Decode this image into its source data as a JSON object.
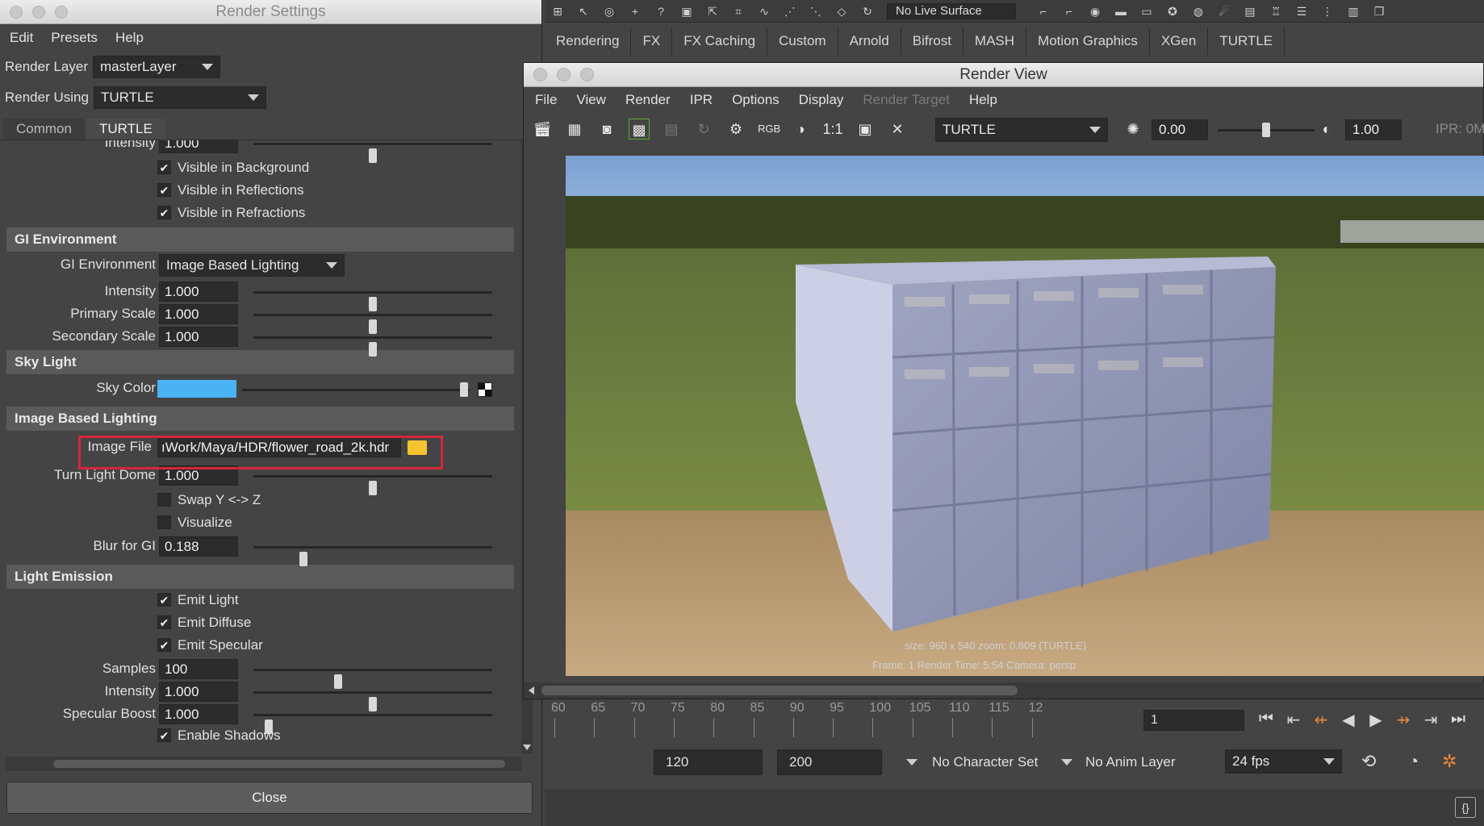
{
  "top_toolbar": {
    "live_surface": "No Live Surface"
  },
  "shelf_tabs": [
    "Rendering",
    "FX",
    "FX Caching",
    "Custom",
    "Arnold",
    "Bifrost",
    "MASH",
    "Motion Graphics",
    "XGen",
    "TURTLE"
  ],
  "render_settings": {
    "title": "Render Settings",
    "menu": [
      "Edit",
      "Presets",
      "Help"
    ],
    "render_layer_label": "Render Layer",
    "render_layer_value": "masterLayer",
    "render_using_label": "Render Using",
    "render_using_value": "TURTLE",
    "tabs": [
      "Common",
      "TURTLE"
    ],
    "active_tab": "TURTLE",
    "top_intensity": {
      "label": "Intensity",
      "value": "1.000",
      "slider": 0.5
    },
    "visible_checks": [
      {
        "label": "Visible in Background",
        "checked": true
      },
      {
        "label": "Visible in Reflections",
        "checked": true
      },
      {
        "label": "Visible in Refractions",
        "checked": true
      }
    ],
    "gi_section": "GI Environment",
    "gi_env_label": "GI Environment",
    "gi_env_value": "Image Based Lighting",
    "gi_fields": [
      {
        "label": "Intensity",
        "value": "1.000",
        "slider": 0.5
      },
      {
        "label": "Primary Scale",
        "value": "1.000",
        "slider": 0.5
      },
      {
        "label": "Secondary Scale",
        "value": "1.000",
        "slider": 0.5
      }
    ],
    "sky_section": "Sky Light",
    "sky_color_label": "Sky Color",
    "sky_color": "#4ab3f4",
    "ibl_section": "Image Based Lighting",
    "image_file_label": "Image File",
    "image_file_value": "ıWork/Maya/HDR/flower_road_2k.hdr",
    "turn_dome": {
      "label": "Turn Light Dome",
      "value": "1.000",
      "slider": 0.5
    },
    "ibl_checks": [
      {
        "label": "Swap Y <-> Z",
        "checked": false
      },
      {
        "label": "Visualize",
        "checked": false
      }
    ],
    "blur_gi": {
      "label": "Blur for GI",
      "value": "0.188",
      "slider": 0.2
    },
    "emission_section": "Light Emission",
    "emission_checks": [
      {
        "label": "Emit Light",
        "checked": true
      },
      {
        "label": "Emit Diffuse",
        "checked": true
      },
      {
        "label": "Emit Specular",
        "checked": true
      }
    ],
    "emission_fields": [
      {
        "label": "Samples",
        "value": "100",
        "slider": 0.35
      },
      {
        "label": "Intensity",
        "value": "1.000",
        "slider": 0.5
      },
      {
        "label": "Specular Boost",
        "value": "1.000",
        "slider": 0.05
      }
    ],
    "enable_shadows": {
      "label": "Enable Shadows",
      "checked": true
    },
    "close_label": "Close"
  },
  "render_view": {
    "title": "Render View",
    "menu": [
      "File",
      "View",
      "Render",
      "IPR",
      "Options",
      "Display",
      "Render Target",
      "Help"
    ],
    "rgb_label": "RGB",
    "ratio_label": "1:1",
    "renderer": "TURTLE",
    "exposure": "0.00",
    "gamma": "1.00",
    "ipr_label": "IPR: 0M",
    "info_line1": "size: 960 x 540 zoom: 0.809        (TURTLE)",
    "info_line2": "Frame: 1        Render Time: 5:54        Camera: persp"
  },
  "timeline": {
    "ticks": [
      "60",
      "65",
      "70",
      "75",
      "80",
      "85",
      "90",
      "95",
      "100",
      "105",
      "110",
      "115",
      "12"
    ],
    "current_frame": "1"
  },
  "range": {
    "end": "120",
    "max": "200",
    "character_set": "No Character Set",
    "anim_layer": "No Anim Layer",
    "fps": "24 fps"
  }
}
